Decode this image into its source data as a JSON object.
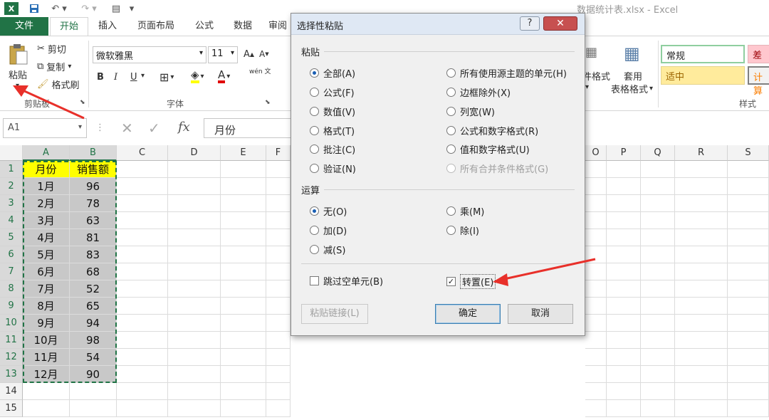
{
  "app": {
    "title": "数据统计表.xlsx - Excel",
    "logo": "X"
  },
  "tabs": [
    "文件",
    "开始",
    "插入",
    "页面布局",
    "公式",
    "数据",
    "审阅"
  ],
  "ribbon": {
    "clipboard": {
      "paste": "粘贴",
      "cut": "剪切",
      "copy": "复制",
      "format_painter": "格式刷",
      "group": "剪贴板"
    },
    "font": {
      "name": "微软雅黑",
      "size": "11",
      "group": "字体",
      "bold": "B",
      "italic": "I",
      "underline": "U",
      "phonetic": "wén 文"
    },
    "styles": {
      "conditional_format": "件格式",
      "table_format": "套用",
      "table_format2": "表格格式",
      "normal": "常规",
      "bad": "差",
      "neutral": "适中",
      "calc": "计算",
      "group": "样式"
    }
  },
  "formula_bar": {
    "name_box": "A1",
    "fx": "fx",
    "content": "月份"
  },
  "columns": [
    "A",
    "B",
    "C",
    "D",
    "E",
    "F",
    "O",
    "P",
    "Q",
    "R",
    "S"
  ],
  "rows": [
    "1",
    "2",
    "3",
    "4",
    "5",
    "6",
    "7",
    "8",
    "9",
    "10",
    "11",
    "12",
    "13",
    "14",
    "15"
  ],
  "table": {
    "header": [
      "月份",
      "销售额"
    ],
    "data": [
      [
        "1月",
        "96"
      ],
      [
        "2月",
        "78"
      ],
      [
        "3月",
        "63"
      ],
      [
        "4月",
        "81"
      ],
      [
        "5月",
        "83"
      ],
      [
        "6月",
        "68"
      ],
      [
        "7月",
        "52"
      ],
      [
        "8月",
        "65"
      ],
      [
        "9月",
        "94"
      ],
      [
        "10月",
        "98"
      ],
      [
        "11月",
        "54"
      ],
      [
        "12月",
        "90"
      ]
    ]
  },
  "dialog": {
    "title": "选择性粘贴",
    "help": "?",
    "close": "✕",
    "paste_section": "粘贴",
    "paste_left": [
      "全部(A)",
      "公式(F)",
      "数值(V)",
      "格式(T)",
      "批注(C)",
      "验证(N)"
    ],
    "paste_right": [
      "所有使用源主题的单元(H)",
      "边框除外(X)",
      "列宽(W)",
      "公式和数字格式(R)",
      "值和数字格式(U)",
      "所有合并条件格式(G)"
    ],
    "op_section": "运算",
    "op_left": [
      "无(O)",
      "加(D)",
      "减(S)"
    ],
    "op_right": [
      "乘(M)",
      "除(I)"
    ],
    "skip_blanks": "跳过空单元(B)",
    "transpose": "转置(E)",
    "transpose_check": "✓",
    "paste_link": "粘贴链接(L)",
    "ok": "确定",
    "cancel": "取消"
  },
  "colors": {
    "accent": "#217346",
    "header_fill": "#ffff00",
    "data_fill": "#c8c8c8",
    "arrow": "#e8302a"
  }
}
